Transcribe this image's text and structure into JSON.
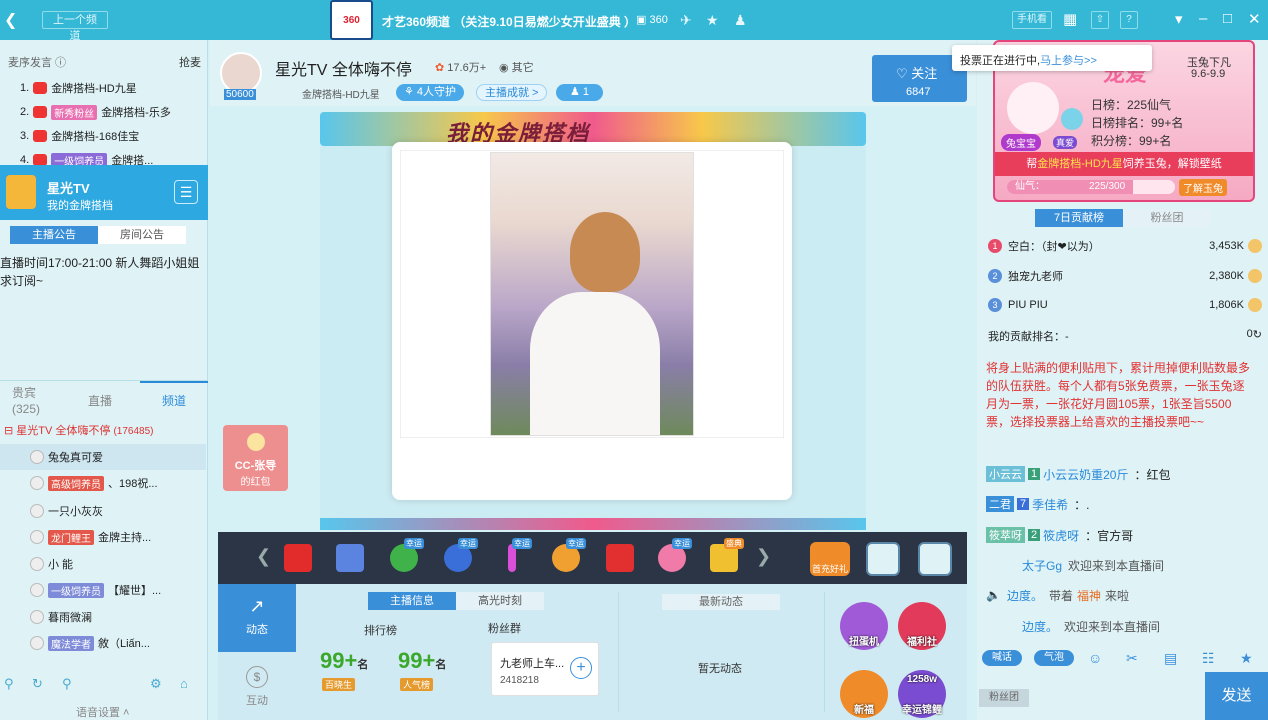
{
  "titlebar": {
    "prev_channel": "上一个频道",
    "logo_text": "360",
    "title": "才艺360频道 （关注9.10日易燃少女开业盛典 ）",
    "channel_id": "360",
    "phone_watch": "手机看"
  },
  "left": {
    "rank_header": "麦序发言",
    "rank_grab": "抢麦",
    "rank_items": [
      {
        "num": "1.",
        "badge": "",
        "name": "金牌搭档-HD九星"
      },
      {
        "num": "2.",
        "badge": "新秀粉丝",
        "name": "金牌搭档-乐多"
      },
      {
        "num": "3.",
        "badge": "",
        "name": "金牌搭档-168佳宝"
      },
      {
        "num": "4.",
        "badge": "一级饲养员",
        "name": "金牌搭..."
      }
    ],
    "star": {
      "name": "星光TV",
      "sub": "我的金牌搭档"
    },
    "tabs": [
      "主播公告",
      "房间公告"
    ],
    "notice": "直播时间17:00-21:00 新人舞蹈小姐姐求订阅~",
    "bottom_tabs": [
      {
        "label": "贵宾",
        "count": "(325)"
      },
      {
        "label": "直播"
      },
      {
        "label": "频道"
      }
    ],
    "channel_title": "星光TV 全体嗨不停",
    "channel_count": "(176485)",
    "users": [
      {
        "lv": "",
        "name": "兔兔真可爱"
      },
      {
        "lv": "高级饲养员",
        "name": "、198祝..."
      },
      {
        "lv": "",
        "name": "一只小灰灰"
      },
      {
        "lv": "龙门鲤王",
        "name": "金牌主持..."
      },
      {
        "lv": "",
        "name": "小 能"
      },
      {
        "lv": "一级饲养员",
        "name": "【耀世】..."
      },
      {
        "lv": "",
        "name": "暮雨微澜"
      },
      {
        "lv": "魔法学者",
        "name": "敘（Liấn..."
      }
    ],
    "voice_settings": "语音设置"
  },
  "anchor": {
    "name": "星光TV 全体嗨不停",
    "heat": "17.6万+",
    "other": "其它",
    "avatar_id": "50600",
    "team": "金牌搭档-HD九星",
    "guards": "4人守护",
    "achievement": "主播成就",
    "fans": "1",
    "follow": "关注",
    "follow_count": "6847"
  },
  "stage": {
    "banner": "我的金牌搭档",
    "redpack_name": "CC-张导",
    "redpack_sub": "的红包"
  },
  "gifts": {
    "items": [
      {
        "name": "red-envelope-icon",
        "tag": "",
        "color": "#e22c2c"
      },
      {
        "name": "game-icon",
        "tag": "",
        "color": "#5a84e0"
      },
      {
        "name": "clover-icon",
        "tag": "幸运",
        "color": "#3fb34a"
      },
      {
        "name": "pinwheel-icon",
        "tag": "幸运",
        "color": "#3a6fd9"
      },
      {
        "name": "glowstick-icon",
        "tag": "幸运",
        "color": "#d94fd9"
      },
      {
        "name": "firework-icon",
        "tag": "幸运",
        "color": "#f0a030"
      },
      {
        "name": "firecracker-icon",
        "tag": "",
        "color": "#e23030"
      },
      {
        "name": "balloon-icon",
        "tag": "幸运",
        "color": "#f07aa8"
      },
      {
        "name": "ticket-icon",
        "tag": "盛典",
        "color": "#f0c030"
      }
    ],
    "first_charge": "首充好礼"
  },
  "info": {
    "dynamic": "动态",
    "interact": "互动",
    "tabs": [
      "主播信息",
      "高光时刻"
    ],
    "rank_label": "排行榜",
    "fans_label": "粉丝群",
    "rank1": "99+",
    "rank1_unit": "名",
    "rank1_tag": "百晓生",
    "rank2": "99+",
    "rank2_unit": "名",
    "rank2_tag": "人气榜",
    "fan_group_name": "九老师上车...",
    "fan_group_id": "2418218",
    "latest": "最新动态",
    "none": "暂无动态",
    "acts": [
      "扭蛋机",
      "福利社",
      "新福",
      "幸运锦鲤"
    ],
    "act_badge": "1258w"
  },
  "right": {
    "vote_text": "投票正在进行中,",
    "vote_link": "马上参与>>",
    "rabbit": {
      "title": "宠爱",
      "date1": "玉兔下凡",
      "date2": "9.6-9.9",
      "day": "日榜：225仙气",
      "rank": "日榜排名：99+名",
      "score": "积分榜：99+名",
      "tag": "兔宝宝",
      "tag2": "真爱",
      "help_pre": "帮",
      "help_name": "金牌搭档-HD九星",
      "help_post": "饲养玉兔，解锁壁纸",
      "bar_label": "仙气：",
      "bar_value": "225/300",
      "bar_fraction": 0.75,
      "know": "了解玉兔"
    },
    "tabs": [
      "7日贡献榜",
      "粉丝团"
    ],
    "contributors": [
      {
        "rank": "1",
        "name": "空白：（封❤以为）",
        "value": "3,453K",
        "color": "#e84a6a"
      },
      {
        "rank": "2",
        "name": "独宠九老师",
        "value": "2,380K",
        "color": "#5a8fd9"
      },
      {
        "rank": "3",
        "name": "PIU PIU",
        "value": "1,806K",
        "color": "#5a8fd9"
      }
    ],
    "my_rank_label": "我的贡献排名：-",
    "my_rank_value": "0",
    "rules": "将身上贴满的便利贴甩下，累计甩掉便利贴数最多的队伍获胜。每个人都有5张免费票，一张玉兔逐月为一票，一张花好月圆105票，1张圣旨5500票，选择投票器上给喜欢的主播投票吧~~",
    "chats": [
      {
        "lv_name": "小云云",
        "lv": "1",
        "user": "小云云奶重20斤",
        "text": "：红包",
        "color": "#6bc0d8"
      },
      {
        "lv_name": "二君",
        "lv": "7",
        "user": "季佳希",
        "text": "：.",
        "color": "#3a8fd9"
      },
      {
        "lv_name": "筱萃呀",
        "lv": "2",
        "user": "筱虎呀",
        "text": "：官方哥",
        "color": "#6bc0a8"
      },
      {
        "lv_name": "",
        "lv": "",
        "user": "太子Gg",
        "text": "欢迎来到本直播间",
        "color": ""
      },
      {
        "lv_name": "",
        "lv": "",
        "user": "边度。",
        "text": "带着",
        "gift": "福神",
        "tail": "来啦",
        "color": ""
      },
      {
        "lv_name": "",
        "lv": "",
        "user": "边度。",
        "text": "欢迎来到本直播间",
        "color": ""
      }
    ],
    "tools": [
      "喊话",
      "气泡"
    ],
    "fan_group": "粉丝团",
    "send": "发送"
  }
}
